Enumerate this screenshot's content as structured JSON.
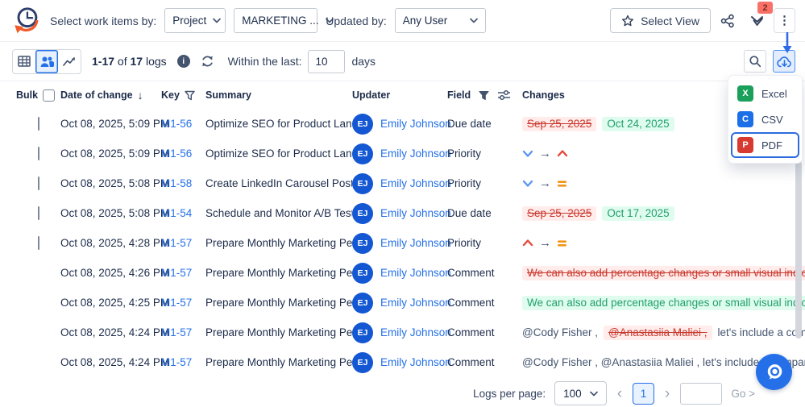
{
  "topbar": {
    "select_label": "Select work items by:",
    "mode_dropdown_value": "Project",
    "project_dropdown_value": "MARKETING ...",
    "updated_by_label": "Updated by:",
    "updated_by_value": "Any User",
    "select_view_label": "Select View",
    "notification_count": "2"
  },
  "toolbar": {
    "count_range": "1-17",
    "count_of": "of",
    "count_total": "17",
    "count_suffix": "logs",
    "info_glyph": "i",
    "within_label": "Within the last:",
    "within_value": "10",
    "days_label": "days"
  },
  "export_menu": {
    "items": [
      {
        "label": "Excel",
        "letter": "X",
        "color": "#1aa05a",
        "selected": false
      },
      {
        "label": "CSV",
        "letter": "C",
        "color": "#1d6fe8",
        "selected": false
      },
      {
        "label": "PDF",
        "letter": "P",
        "color": "#d63a30",
        "selected": true
      }
    ]
  },
  "table": {
    "headers": {
      "bulk": "Bulk",
      "date": "Date of change",
      "key": "Key",
      "summary": "Summary",
      "updater": "Updater",
      "field": "Field",
      "changes": "Changes"
    },
    "rows": [
      {
        "date": "Oct 08, 2025, 5:09 PM",
        "key": "M1-56",
        "summary": "Optimize SEO for Product Landi...",
        "updater": "Emily Johnson",
        "initials": "EJ",
        "field": "Due date",
        "disabled": false,
        "changes": [
          {
            "t": "removed",
            "text": "Sep 25, 2025"
          },
          {
            "t": "added",
            "text": "Oct 24, 2025"
          }
        ]
      },
      {
        "date": "Oct 08, 2025, 5:09 PM",
        "key": "M1-56",
        "summary": "Optimize SEO for Product Landi...",
        "updater": "Emily Johnson",
        "initials": "EJ",
        "field": "Priority",
        "disabled": false,
        "changes": [
          {
            "t": "priority",
            "from": "low",
            "to": "highest"
          }
        ]
      },
      {
        "date": "Oct 08, 2025, 5:08 PM",
        "key": "M1-58",
        "summary": "Create LinkedIn Carousel Post",
        "updater": "Emily Johnson",
        "initials": "EJ",
        "field": "Priority",
        "disabled": false,
        "changes": [
          {
            "t": "priority",
            "from": "low",
            "to": "medium"
          }
        ]
      },
      {
        "date": "Oct 08, 2025, 5:08 PM",
        "key": "M1-54",
        "summary": "Schedule and Monitor A/B Test ...",
        "updater": "Emily Johnson",
        "initials": "EJ",
        "field": "Due date",
        "disabled": false,
        "changes": [
          {
            "t": "removed",
            "text": "Sep 25, 2025"
          },
          {
            "t": "added",
            "text": "Oct 17, 2025"
          }
        ]
      },
      {
        "date": "Oct 08, 2025, 4:28 PM",
        "key": "M1-57",
        "summary": "Prepare Monthly Marketing Perf...",
        "updater": "Emily Johnson",
        "initials": "EJ",
        "field": "Priority",
        "disabled": false,
        "changes": [
          {
            "t": "priority",
            "from": "high",
            "to": "medium"
          }
        ]
      },
      {
        "date": "Oct 08, 2025, 4:26 PM",
        "key": "M1-57",
        "summary": "Prepare Monthly Marketing Perf...",
        "updater": "Emily Johnson",
        "initials": "EJ",
        "field": "Comment",
        "disabled": true,
        "changes": [
          {
            "t": "removed",
            "text": "We can also add percentage changes or small visual indicators."
          }
        ]
      },
      {
        "date": "Oct 08, 2025, 4:25 PM",
        "key": "M1-57",
        "summary": "Prepare Monthly Marketing Perf...",
        "updater": "Emily Johnson",
        "initials": "EJ",
        "field": "Comment",
        "disabled": true,
        "changes": [
          {
            "t": "added",
            "text": "We can also add percentage changes or small visual indicators."
          }
        ]
      },
      {
        "date": "Oct 08, 2025, 4:24 PM",
        "key": "M1-57",
        "summary": "Prepare Monthly Marketing Perf...",
        "updater": "Emily Johnson",
        "initials": "EJ",
        "field": "Comment",
        "disabled": true,
        "changes": [
          {
            "t": "text",
            "text": "@Cody Fisher ,"
          },
          {
            "t": "removed",
            "text": "@Anastasiia Maliei ,"
          },
          {
            "t": "text",
            "text": "let's include a comparison ..."
          }
        ]
      },
      {
        "date": "Oct 08, 2025, 4:24 PM",
        "key": "M1-57",
        "summary": "Prepare Monthly Marketing Perf...",
        "updater": "Emily Johnson",
        "initials": "EJ",
        "field": "Comment",
        "disabled": true,
        "changes": [
          {
            "t": "text",
            "text": "@Cody Fisher , @Anastasiia Maliei , let's include a comparis..."
          }
        ]
      }
    ]
  },
  "footer": {
    "logs_per_page_label": "Logs per page:",
    "page_size_value": "100",
    "current_page": "1",
    "go_label": "Go >"
  },
  "glyphs": {
    "arrow": "→",
    "sort_desc": "↓",
    "prev": "‹",
    "next": "›",
    "more_dots": "⋮"
  },
  "colors": {
    "accent": "#2570e8",
    "avatar": "#1457d3",
    "added_text": "#22a06b",
    "added_bg": "#dffcef",
    "removed_text": "#c9372c",
    "removed_bg": "#ffeceb",
    "priority_low": "#5a96f5",
    "priority_high": "#e5493a",
    "priority_medium": "#f0941a",
    "badge_bg": "#f87168"
  }
}
